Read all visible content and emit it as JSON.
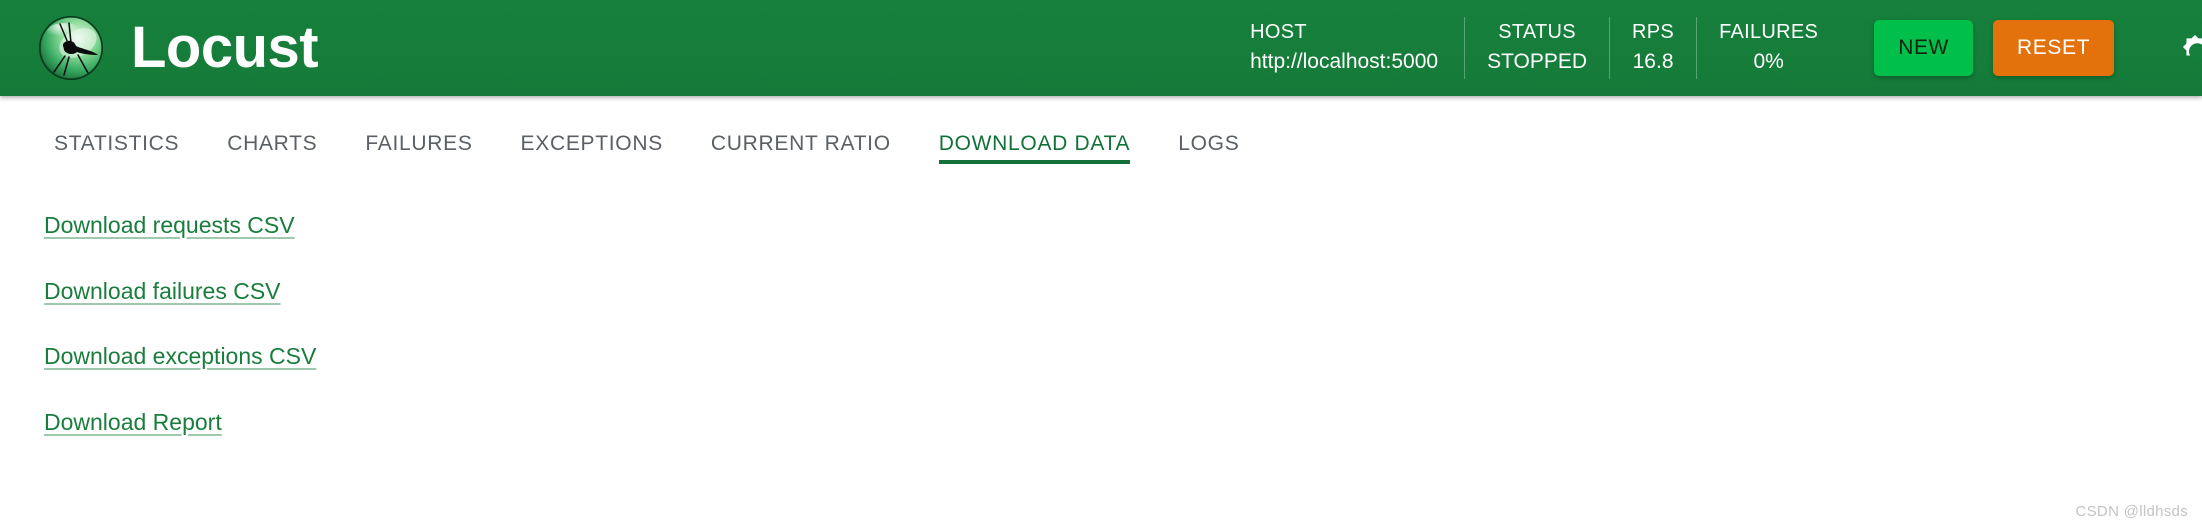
{
  "header": {
    "brand_title": "Locust",
    "logo_icon": "locust-logo-icon",
    "stats": [
      {
        "label": "HOST",
        "value": "http://localhost:5000"
      },
      {
        "label": "STATUS",
        "value": "STOPPED"
      },
      {
        "label": "RPS",
        "value": "16.8"
      },
      {
        "label": "FAILURES",
        "value": "0%"
      }
    ],
    "new_button": "NEW",
    "reset_button": "RESET",
    "theme_toggle_icon": "dark-mode-icon",
    "colors": {
      "header_bg": "#15803d",
      "new_button_bg": "#00c04b",
      "reset_button_bg": "#e4720c",
      "accent_green": "#137038"
    }
  },
  "tabs": [
    {
      "label": "STATISTICS",
      "active": false
    },
    {
      "label": "CHARTS",
      "active": false
    },
    {
      "label": "FAILURES",
      "active": false
    },
    {
      "label": "EXCEPTIONS",
      "active": false
    },
    {
      "label": "CURRENT RATIO",
      "active": false
    },
    {
      "label": "DOWNLOAD DATA",
      "active": true
    },
    {
      "label": "LOGS",
      "active": false
    }
  ],
  "content": {
    "links": [
      "Download requests CSV",
      "Download failures CSV",
      "Download exceptions CSV",
      "Download Report"
    ]
  },
  "watermark": "CSDN @lldhsds"
}
